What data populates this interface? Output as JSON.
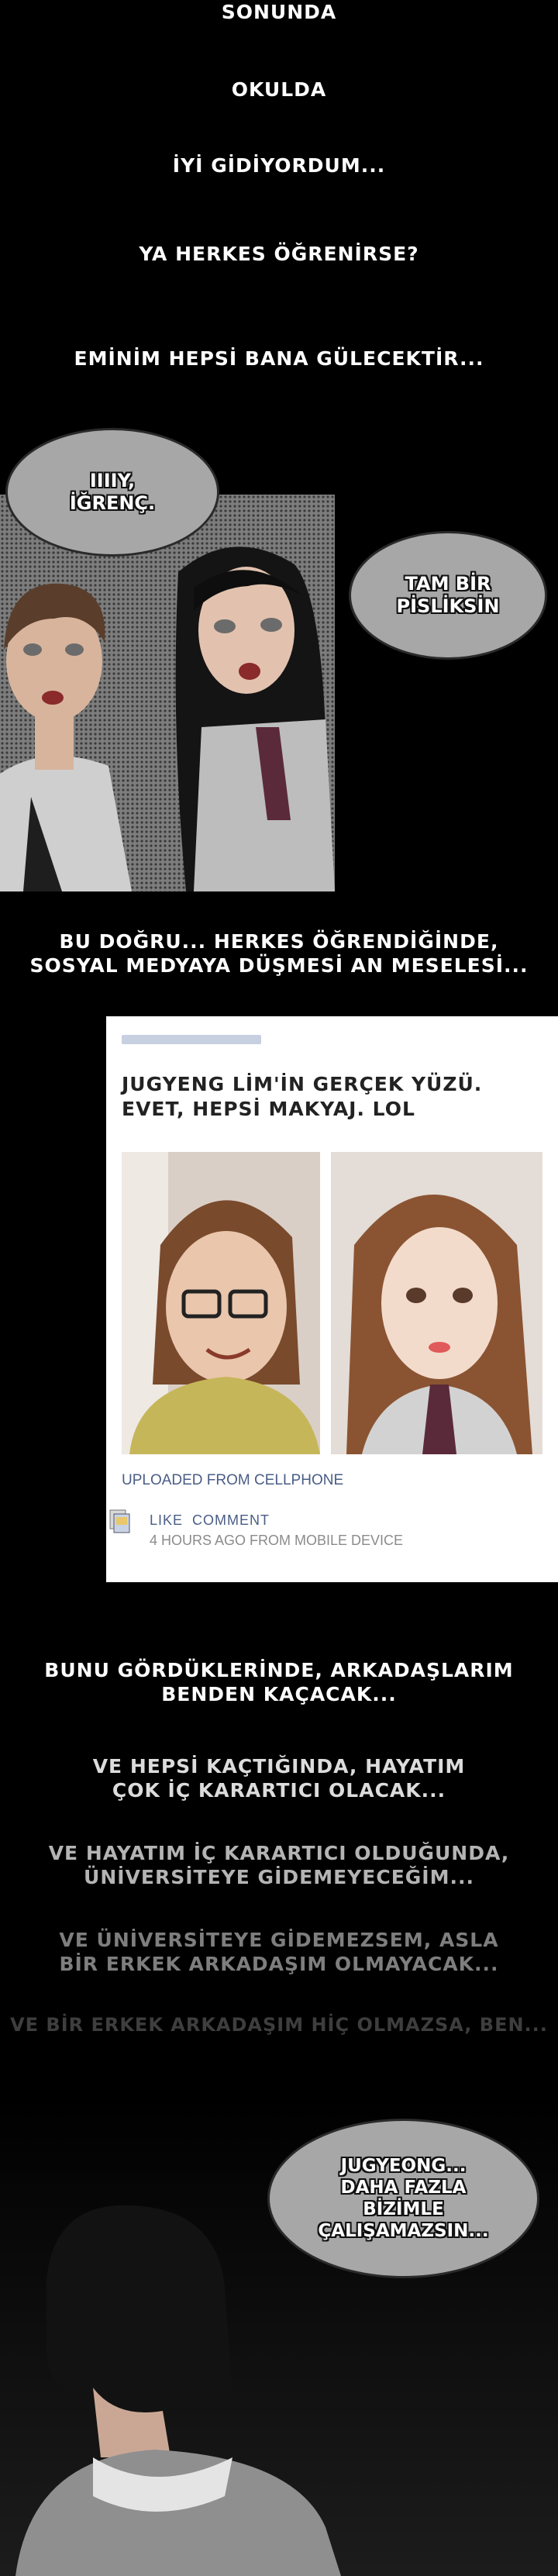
{
  "captions": {
    "c1": "SONUNDA",
    "c2": "OKULDA",
    "c3": "İYİ GİDİYORDUM...",
    "c4": "YA HERKES ÖĞRENİRSE?",
    "c5": "EMİNİM HEPSİ BANA GÜLECEKTİR...",
    "c6": "BU DOĞRU... HERKES ÖĞRENDİĞİNDE,\nSOSYAL MEDYAYA DÜŞMESİ AN MESELESİ...",
    "c7": "BUNU GÖRDÜKLERİNDE, ARKADAŞLARIM\nBENDEN KAÇACAK...",
    "c8": "VE HEPSİ KAÇTIĞINDA, HAYATIM\nÇOK İÇ KARARTICI OLACAK...",
    "c9": "VE HAYATIM İÇ KARARTICI OLDUĞUNDA,\nÜNİVERSİTEYE GİDEMEYECEĞİM...",
    "c10": "VE ÜNİVERSİTEYE GİDEMEZSEM, ASLA\nBİR ERKEK ARKADAŞIM OLMAYACAK...",
    "c11": "VE BİR ERKEK ARKADAŞIM HİÇ OLMAZSA, BEN..."
  },
  "bubbles": {
    "b1": "IIIIY,\nİĞRENÇ.",
    "b2": "TAM BİR\nPİSLİKSİN",
    "b3": "JUGYEONG...\nDAHA FAZLA\nBİZİMLE\nÇALIŞAMAZSIN..."
  },
  "post": {
    "text": "JUGYENG LİM'İN GERÇEK YÜZÜ.\nEVET, HEPSİ MAKYAJ. LOL",
    "uploaded": "UPLOADED FROM CELLPHONE",
    "like": "LIKE",
    "comment": "COMMENT",
    "time": "4 HOURS AGO FROM MOBILE DEVICE"
  },
  "colors": {
    "background": "#000000",
    "bubble": "#a7a7a7",
    "link": "#4a5d86"
  }
}
